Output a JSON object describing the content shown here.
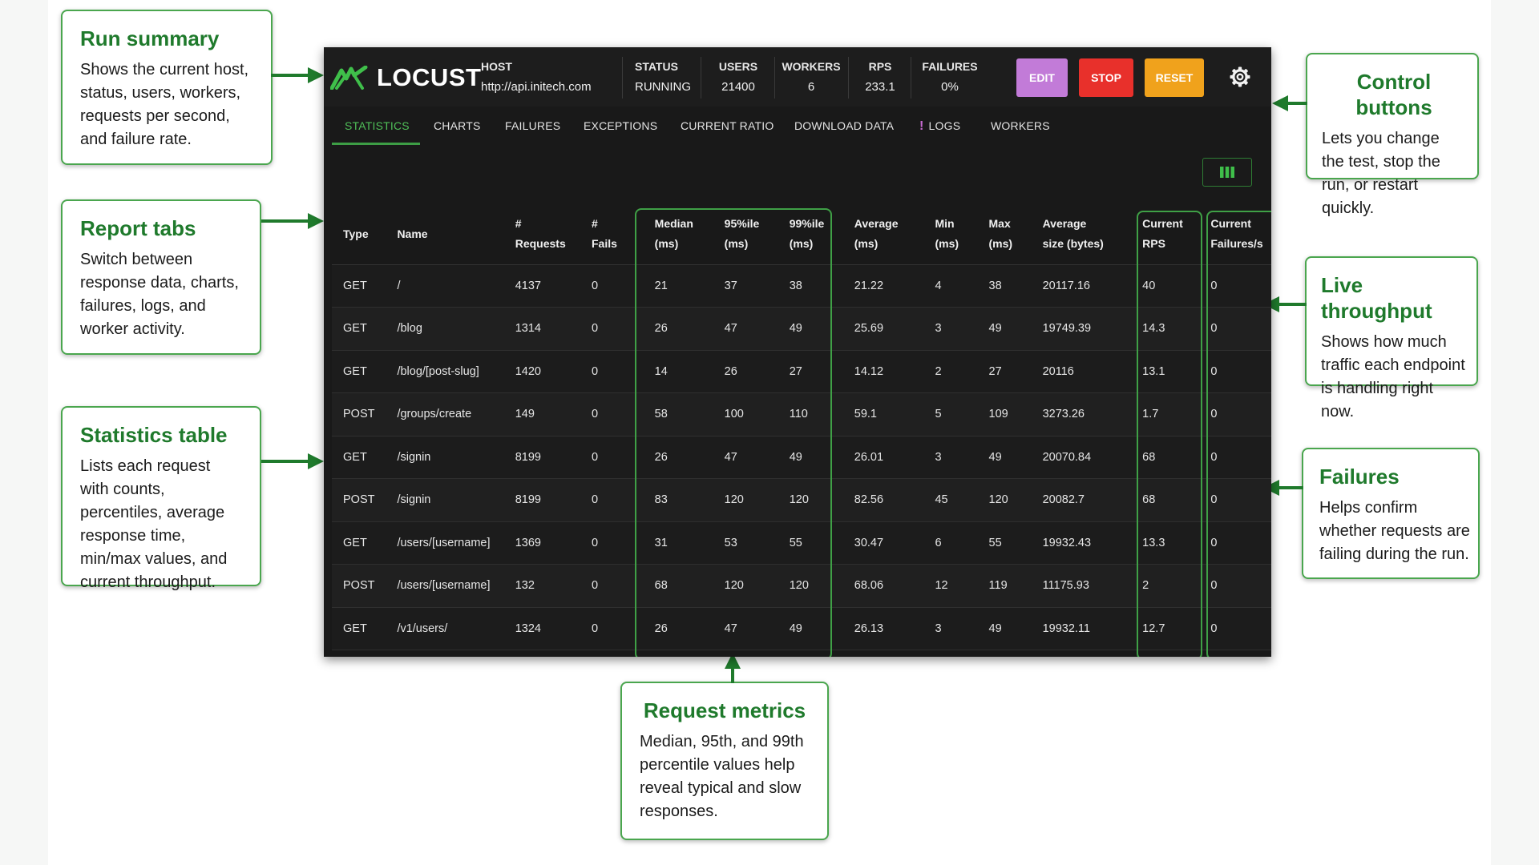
{
  "annotations": {
    "run_summary": {
      "title": "Run summary",
      "body": "Shows the current host, status, users, workers, requests per second, and failure rate."
    },
    "report_tabs": {
      "title": "Report tabs",
      "body": "Switch between response data, charts, failures, logs, and worker activity."
    },
    "statistics_table": {
      "title": "Statistics table",
      "body": "Lists each request with counts, percentiles, average response time, min/max values, and current throughput."
    },
    "control_buttons": {
      "title": "Control buttons",
      "body": "Lets you change the test, stop the run, or restart quickly."
    },
    "live_throughput": {
      "title": "Live throughput",
      "body": "Shows how much traffic each endpoint is handling right now."
    },
    "failures": {
      "title": "Failures",
      "body": "Helps confirm whether requests are failing during the run."
    },
    "request_metrics": {
      "title": "Request metrics",
      "body": "Median, 95th, and 99th percentile values help reveal typical and slow responses."
    }
  },
  "app": {
    "logo": "LOCUST",
    "host": {
      "label": "HOST",
      "value": "http://api.initech.com"
    },
    "status": {
      "label": "STATUS",
      "value": "RUNNING"
    },
    "users": {
      "label": "USERS",
      "value": "21400"
    },
    "workers": {
      "label": "WORKERS",
      "value": "6"
    },
    "rps": {
      "label": "RPS",
      "value": "233.1"
    },
    "failures": {
      "label": "FAILURES",
      "value": "0%"
    },
    "buttons": {
      "edit": "EDIT",
      "stop": "STOP",
      "reset": "RESET"
    },
    "tabs": [
      "STATISTICS",
      "CHARTS",
      "FAILURES",
      "EXCEPTIONS",
      "CURRENT RATIO",
      "DOWNLOAD DATA",
      "LOGS",
      "WORKERS"
    ],
    "logs_warning": "!",
    "active_tab": "STATISTICS"
  },
  "colors": {
    "accent_green": "#4fbf58",
    "edit": "#c27bd8",
    "stop": "#e8302b",
    "reset": "#f0a21c",
    "annotation_title": "#1f7a2c"
  },
  "icons": {
    "logo": "locust-logo-icon",
    "settings": "gear-icon",
    "columns": "columns-icon",
    "logs_alert": "exclamation-icon"
  },
  "table": {
    "columns": [
      [
        "Type"
      ],
      [
        "Name"
      ],
      [
        "#",
        "Requests"
      ],
      [
        "#",
        "Fails"
      ],
      [
        "Median",
        "(ms)"
      ],
      [
        "95%ile",
        "(ms)"
      ],
      [
        "99%ile",
        "(ms)"
      ],
      [
        "Average",
        "(ms)"
      ],
      [
        "Min",
        "(ms)"
      ],
      [
        "Max",
        "(ms)"
      ],
      [
        "Average",
        "size (bytes)"
      ],
      [
        "Current",
        "RPS"
      ],
      [
        "Current",
        "Failures/s"
      ]
    ],
    "rows": [
      [
        "GET",
        "/",
        "4137",
        "0",
        "21",
        "37",
        "38",
        "21.22",
        "4",
        "38",
        "20117.16",
        "40",
        "0"
      ],
      [
        "GET",
        "/blog",
        "1314",
        "0",
        "26",
        "47",
        "49",
        "25.69",
        "3",
        "49",
        "19749.39",
        "14.3",
        "0"
      ],
      [
        "GET",
        "/blog/[post-slug]",
        "1420",
        "0",
        "14",
        "26",
        "27",
        "14.12",
        "2",
        "27",
        "20116",
        "13.1",
        "0"
      ],
      [
        "POST",
        "/groups/create",
        "149",
        "0",
        "58",
        "100",
        "110",
        "59.1",
        "5",
        "109",
        "3273.26",
        "1.7",
        "0"
      ],
      [
        "GET",
        "/signin",
        "8199",
        "0",
        "26",
        "47",
        "49",
        "26.01",
        "3",
        "49",
        "20070.84",
        "68",
        "0"
      ],
      [
        "POST",
        "/signin",
        "8199",
        "0",
        "83",
        "120",
        "120",
        "82.56",
        "45",
        "120",
        "20082.7",
        "68",
        "0"
      ],
      [
        "GET",
        "/users/[username]",
        "1369",
        "0",
        "31",
        "53",
        "55",
        "30.47",
        "6",
        "55",
        "19932.43",
        "13.3",
        "0"
      ],
      [
        "POST",
        "/users/[username]",
        "132",
        "0",
        "68",
        "120",
        "120",
        "68.06",
        "12",
        "119",
        "11175.93",
        "2",
        "0"
      ],
      [
        "GET",
        "/v1/users/",
        "1324",
        "0",
        "26",
        "47",
        "49",
        "26.13",
        "3",
        "49",
        "19932.11",
        "12.7",
        "0"
      ]
    ]
  }
}
